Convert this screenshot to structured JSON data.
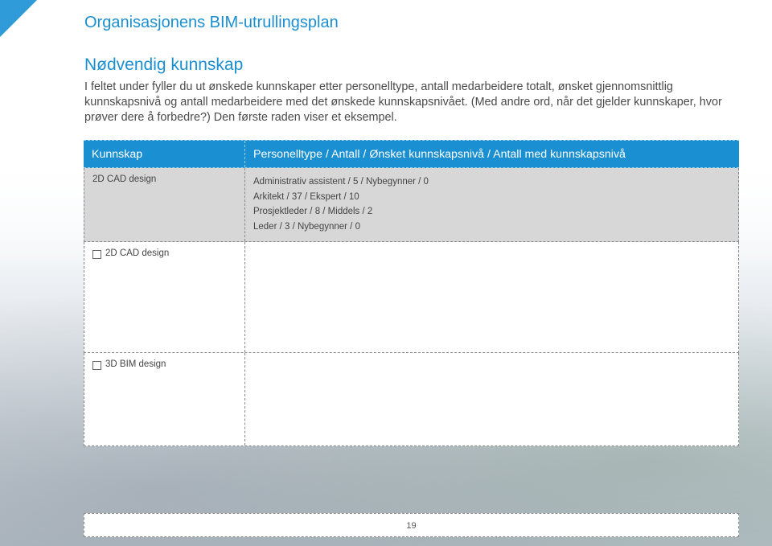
{
  "header": {
    "title": "Organisasjonens BIM-utrullingsplan"
  },
  "section": {
    "title": "Nødvendig kunnskap",
    "intro": "I feltet under fyller du ut ønskede kunnskaper etter personelltype, antall medarbeidere totalt, ønsket gjennomsnittlig kunnskapsnivå og antall medarbeidere med det ønskede kunnskapsnivået. (Med andre ord, når det gjelder kunnskaper, hvor prøver dere å forbedre?) Den første raden viser et eksempel."
  },
  "table": {
    "headers": [
      "Kunnskap",
      "Personelltype / Antall / Ønsket kunnskapsnivå / Antall med kunnskapsnivå"
    ],
    "example": {
      "skill": "2D CAD design",
      "entries": [
        "Administrativ assistent / 5 / Nybegynner / 0",
        "Arkitekt / 37 / Ekspert / 10",
        "Prosjektleder / 8 / Middels / 2",
        "Leder / 3 / Nybegynner / 0"
      ]
    },
    "rows": [
      {
        "skill": "2D CAD design"
      },
      {
        "skill": "3D BIM design"
      }
    ]
  },
  "footer": {
    "page_number": "19"
  },
  "colors": {
    "accent": "#1a8fd1",
    "example_row": "#d7d7d7"
  }
}
